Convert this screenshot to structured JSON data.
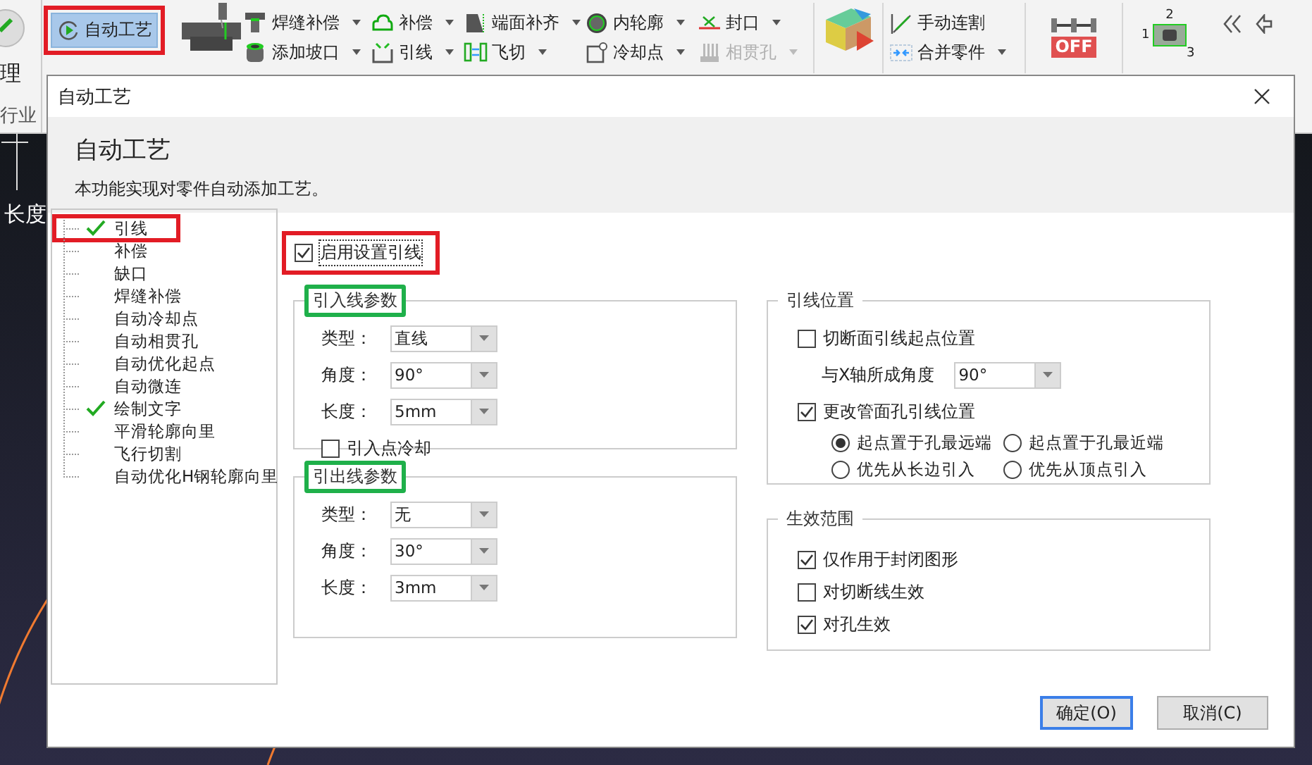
{
  "app": {
    "ribbon": {
      "cut_label": "理",
      "section_label": "行业",
      "auto_button": {
        "label": "自动工艺",
        "selected": true,
        "highlighted": true
      },
      "columns": [
        [
          {
            "kind": "tee",
            "label": "焊缝补偿",
            "dropdown": true,
            "disabled": false
          },
          {
            "kind": "cylinder",
            "label": "添加坡口",
            "dropdown": true,
            "disabled": false
          }
        ],
        [
          {
            "kind": "cloud",
            "label": "补偿",
            "dropdown": true,
            "disabled": false
          },
          {
            "kind": "bracket",
            "label": "引线",
            "dropdown": true,
            "disabled": false
          }
        ],
        [
          {
            "kind": "trapezoid",
            "label": "端面补齐",
            "dropdown": true,
            "disabled": false
          },
          {
            "kind": "split",
            "label": "飞切",
            "dropdown": true,
            "disabled": false
          }
        ],
        [
          {
            "kind": "ring",
            "label": "内轮廓",
            "dropdown": true,
            "disabled": false
          },
          {
            "kind": "square",
            "label": "冷却点",
            "dropdown": true,
            "disabled": false
          }
        ],
        [
          {
            "kind": "cross",
            "label": "封口",
            "dropdown": true,
            "disabled": false
          },
          {
            "kind": "comb",
            "label": "相贯孔",
            "dropdown": true,
            "disabled": true
          }
        ],
        [
          {
            "kind": "diagonal",
            "label": "手动连割",
            "dropdown": false,
            "disabled": false
          },
          {
            "kind": "arrows",
            "label": "合并零件",
            "dropdown": true,
            "disabled": false
          }
        ]
      ],
      "off_badge": "OFF",
      "sort_digits": [
        "2",
        "1",
        "3"
      ]
    },
    "canvas_label": "长度"
  },
  "dialog": {
    "title": "自动工艺",
    "heading": "自动工艺",
    "description": "本功能实现对零件自动添加工艺。",
    "tree": [
      {
        "label": "引线",
        "checked": true,
        "highlighted": true
      },
      {
        "label": "补偿",
        "checked": false,
        "highlighted": false
      },
      {
        "label": "缺口",
        "checked": false,
        "highlighted": false
      },
      {
        "label": "焊缝补偿",
        "checked": false,
        "highlighted": false
      },
      {
        "label": "自动冷却点",
        "checked": false,
        "highlighted": false
      },
      {
        "label": "自动相贯孔",
        "checked": false,
        "highlighted": false
      },
      {
        "label": "自动优化起点",
        "checked": false,
        "highlighted": false
      },
      {
        "label": "自动微连",
        "checked": false,
        "highlighted": false
      },
      {
        "label": "绘制文字",
        "checked": true,
        "highlighted": false
      },
      {
        "label": "平滑轮廓向里",
        "checked": false,
        "highlighted": false
      },
      {
        "label": "飞行切割",
        "checked": false,
        "highlighted": false
      },
      {
        "label": "自动优化H钢轮廓向里",
        "checked": false,
        "highlighted": false
      }
    ],
    "enable": {
      "label": "启用设置引线",
      "checked": true,
      "focused": true,
      "highlighted": true
    },
    "lead_in": {
      "title": "引入线参数",
      "highlighted": true,
      "fields": [
        {
          "label": "类型：",
          "value": "直线"
        },
        {
          "label": "角度：",
          "value": "90°"
        },
        {
          "label": "长度：",
          "value": "5mm"
        }
      ],
      "cooling": {
        "label": "引入点冷却",
        "checked": false
      }
    },
    "lead_out": {
      "title": "引出线参数",
      "highlighted": true,
      "fields": [
        {
          "label": "类型：",
          "value": "无"
        },
        {
          "label": "角度：",
          "value": "30°"
        },
        {
          "label": "长度：",
          "value": "3mm"
        }
      ]
    },
    "position": {
      "title": "引线位置",
      "section_check": {
        "label": "切断面引线起点位置",
        "checked": false
      },
      "angle": {
        "label": "与X轴所成角度",
        "value": "90°"
      },
      "pipe_check": {
        "label": "更改管面孔引线位置",
        "checked": true
      },
      "radios": [
        {
          "label": "起点置于孔最远端",
          "selected": true
        },
        {
          "label": "起点置于孔最近端",
          "selected": false
        },
        {
          "label": "优先从长边引入",
          "selected": false
        },
        {
          "label": "优先从顶点引入",
          "selected": false
        }
      ]
    },
    "scope": {
      "title": "生效范围",
      "checks": [
        {
          "label": "仅作用于封闭图形",
          "checked": true
        },
        {
          "label": "对切断线生效",
          "checked": false
        },
        {
          "label": "对孔生效",
          "checked": true
        }
      ]
    },
    "buttons": [
      {
        "label": "确定(O)",
        "default": true
      },
      {
        "label": "取消(C)",
        "default": false
      }
    ]
  }
}
